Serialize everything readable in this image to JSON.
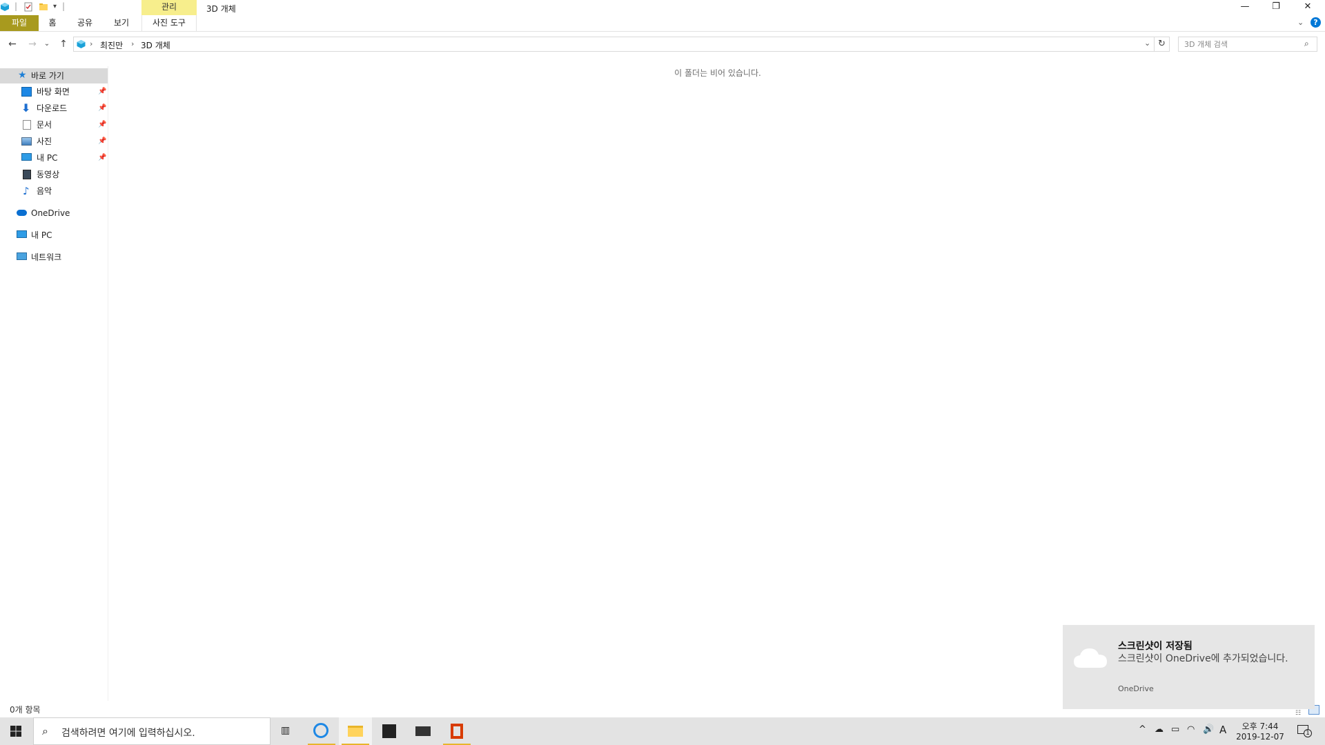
{
  "window": {
    "title": "3D 개체",
    "contextual_tab_group": "관리"
  },
  "ribbon": {
    "tabs": [
      "파일",
      "홈",
      "공유",
      "보기"
    ],
    "contextual_tab": "사진 도구"
  },
  "address": {
    "breadcrumb": [
      "최진만",
      "3D 개체"
    ],
    "search_placeholder": "3D 개체 검색"
  },
  "nav": {
    "quick_access": "바로 가기",
    "pinned": [
      {
        "label": "바탕 화면",
        "icon": "desktop-icon",
        "pinned": true
      },
      {
        "label": "다운로드",
        "icon": "download-icon",
        "pinned": true
      },
      {
        "label": "문서",
        "icon": "documents-icon",
        "pinned": true
      },
      {
        "label": "사진",
        "icon": "pictures-icon",
        "pinned": true
      },
      {
        "label": "내 PC",
        "icon": "pc-icon",
        "pinned": true
      },
      {
        "label": "동영상",
        "icon": "videos-icon",
        "pinned": false
      },
      {
        "label": "음악",
        "icon": "music-icon",
        "pinned": false
      }
    ],
    "onedrive": "OneDrive",
    "this_pc": "내 PC",
    "network": "네트워크"
  },
  "content": {
    "empty_message": "이 폴더는 비어 있습니다."
  },
  "status": {
    "item_count": "0개 항목"
  },
  "toast": {
    "title": "스크린샷이 저장됨",
    "body": "스크린샷이 OneDrive에 추가되었습니다.",
    "source": "OneDrive"
  },
  "taskbar": {
    "search_text": "검색하려면 여기에 입력하십시오.",
    "clock_time": "오후 7:44",
    "clock_date": "2019-12-07",
    "ime": "A",
    "notification_count": "1"
  },
  "colors": {
    "file_tab": "#a89a1e",
    "contextual_tab": "#f7ee8c",
    "nav_selected": "#d9d9d9",
    "accent_blue": "#0078d7",
    "taskbar_bg": "#e3e3e3",
    "taskbar_active": "#e8b52a"
  }
}
